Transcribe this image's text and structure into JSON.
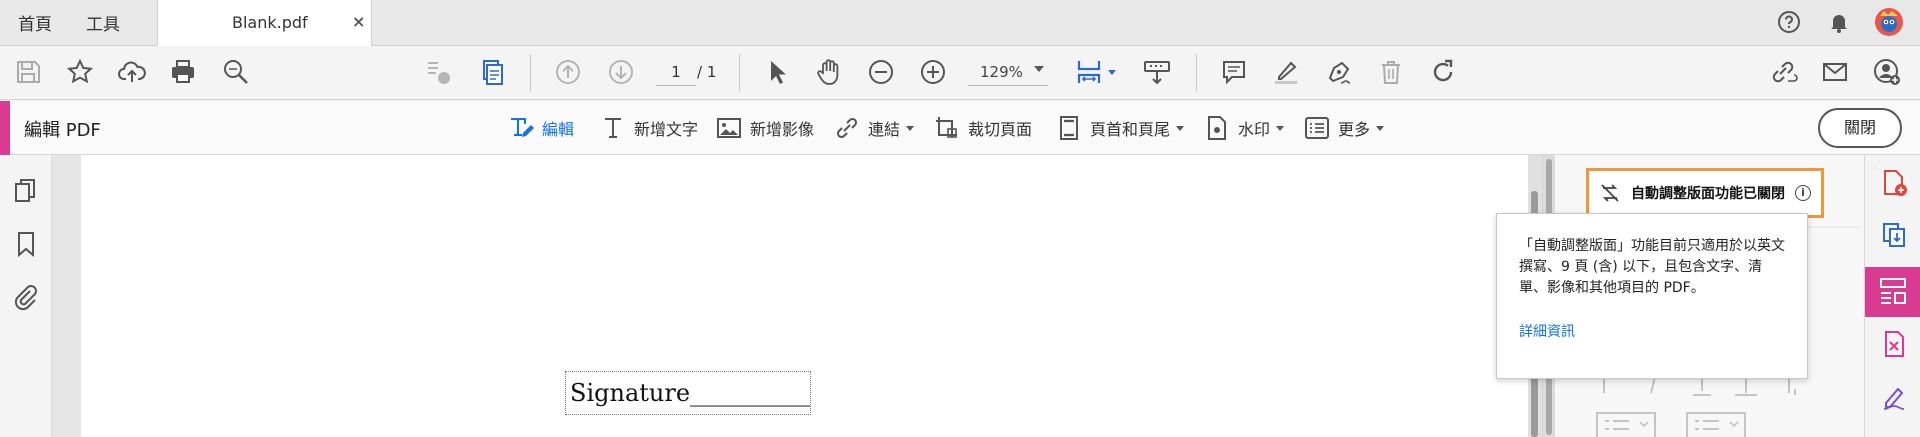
{
  "tabs": {
    "home": "首頁",
    "tools": "工具",
    "document": "Blank.pdf",
    "close_symbol": "×"
  },
  "toolbar": {
    "page_current": "1",
    "page_total": "/ 1",
    "zoom": "129%"
  },
  "edit_bar": {
    "title": "編輯 PDF",
    "tools": {
      "edit": "編輯",
      "add_text": "新增文字",
      "add_image": "新增影像",
      "link": "連結",
      "crop": "裁切頁面",
      "header_footer": "頁首和頁尾",
      "watermark": "水印",
      "more": "更多"
    },
    "close": "關閉"
  },
  "document": {
    "signature_text": "Signature__________"
  },
  "reflow": {
    "status": "自動調整版面功能已關閉",
    "info_symbol": "i",
    "tooltip_body": "「自動調整版面」功能目前只適用於以英文撰寫、9 頁 (含) 以下，且包含文字、清單、影像和其他項目的 PDF。",
    "tooltip_link": "詳細資訊"
  },
  "colors": {
    "accent": "#d83b8f",
    "link": "#1473e6",
    "highlight_border": "#f0963c",
    "active_tool": "#1473e6"
  }
}
